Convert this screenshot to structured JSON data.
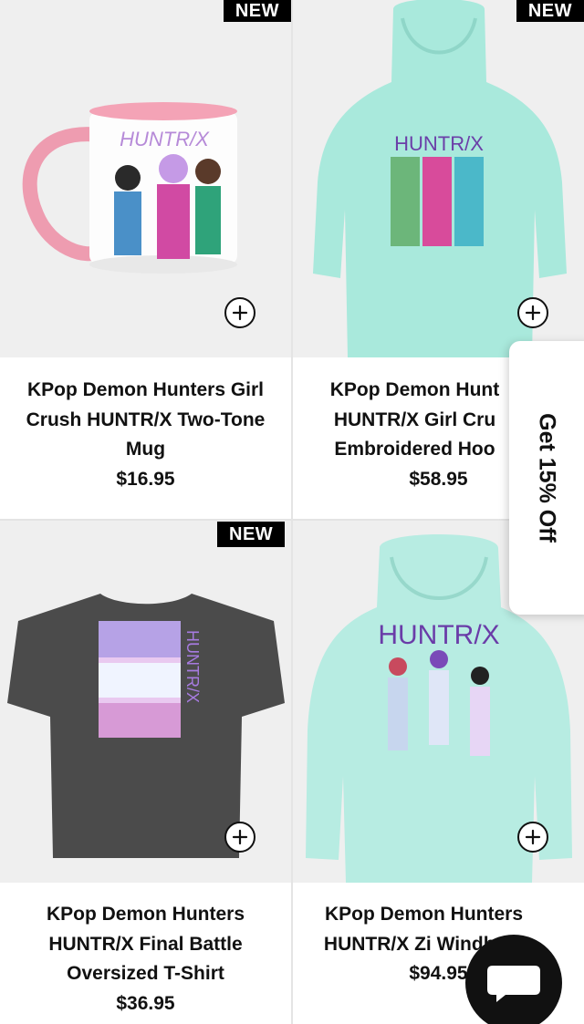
{
  "badges": {
    "new": "NEW"
  },
  "products": [
    {
      "title": "KPop Demon Hunters Girl Crush HUNTR/X Two-Tone Mug",
      "price": "$16.95",
      "badge": "NEW",
      "graphic_text": "HUNTR/X"
    },
    {
      "title": "KPop Demon Hunters HUNTR/X Girl Crush Embroidered Hoodie",
      "title_visible": "KPop Demon Hunt HUNTR/X Girl Cru Embroidered Hoo",
      "price": "$58.95",
      "badge": "NEW",
      "graphic_text": "HUNTR/X"
    },
    {
      "title": "KPop Demon Hunters HUNTR/X Final Battle Oversized T-Shirt",
      "price": "$36.95",
      "badge": "NEW",
      "graphic_text": "HUNTR/X"
    },
    {
      "title_visible": "KPop Demon Hunters HUNTR/X Zi Windbrea",
      "price": "$94.95",
      "graphic_text": "HUNTR/X"
    }
  ],
  "promo": {
    "label": "Get 15% Off"
  },
  "colors": {
    "mint": "#a9e9dc",
    "mug_pink": "#f2a7b8",
    "shirt_gray": "#4b4b4b",
    "badge_bg": "#000000"
  },
  "icons": {
    "add": "plus-circle-icon",
    "chat": "chat-bubble-icon"
  }
}
